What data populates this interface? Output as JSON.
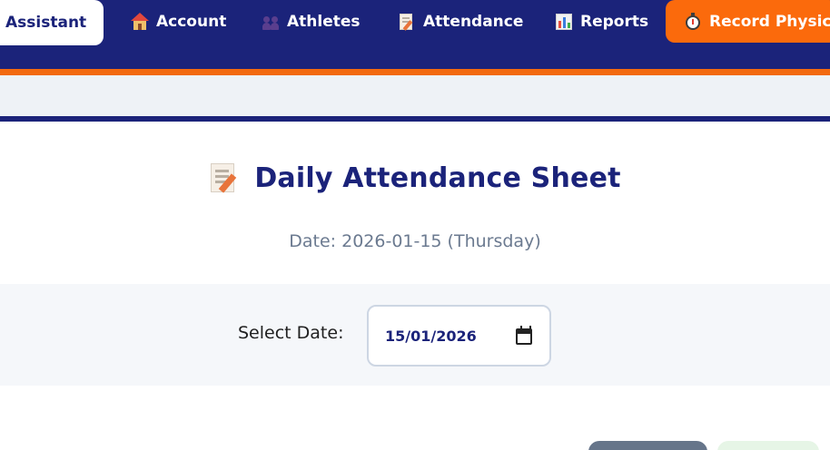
{
  "nav": {
    "tabs": [
      {
        "label": "Assistant",
        "icon": "",
        "active": true
      },
      {
        "label": "Account",
        "icon": "house-icon"
      },
      {
        "label": "Athletes",
        "icon": "people-icon"
      },
      {
        "label": "Attendance",
        "icon": "memo-icon"
      },
      {
        "label": "Reports",
        "icon": "bar-chart-icon"
      },
      {
        "label": "Record Physical",
        "icon": "stopwatch-icon",
        "highlighted": true
      }
    ]
  },
  "colors": {
    "brand": "#1b237a",
    "accent": "#f26a0f",
    "muted_text": "#6b7a90"
  },
  "page": {
    "title_icon": "memo-icon",
    "title": "Daily Attendance Sheet",
    "date_line": "Date: 2026-01-15 (Thursday)"
  },
  "date_selector": {
    "label": "Select Date:",
    "value": "15/01/2026",
    "icon": "calendar-icon"
  }
}
